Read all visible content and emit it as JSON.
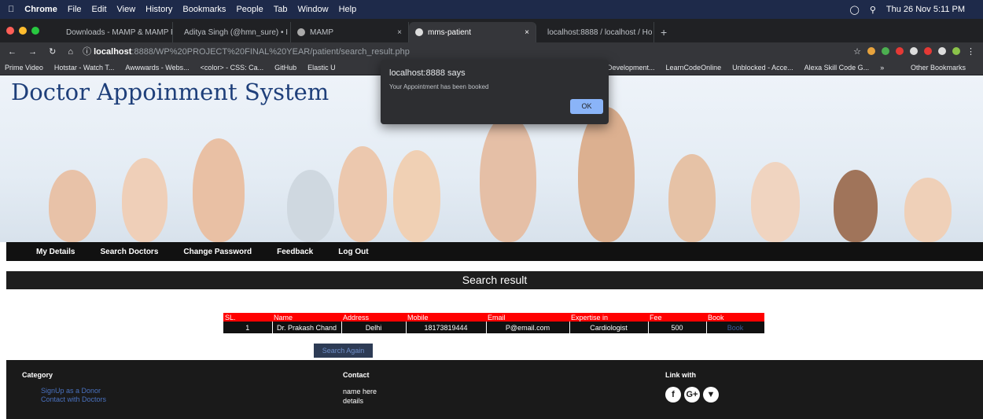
{
  "mac_menu": {
    "app": "Chrome",
    "items": [
      "File",
      "Edit",
      "View",
      "History",
      "Bookmarks",
      "People",
      "Tab",
      "Window",
      "Help"
    ],
    "datetime": "Thu 26 Nov 5:11 PM"
  },
  "tabs": [
    {
      "label": "Downloads - MAMP & MAMP P",
      "icon": "mamp-icon"
    },
    {
      "label": "Aditya Singh (@hmn_sure) • I",
      "icon": "instagram-icon"
    },
    {
      "label": "MAMP",
      "icon": "mamp-icon"
    },
    {
      "label": "mms-patient",
      "icon": "mamp-icon",
      "active": true
    },
    {
      "label": "localhost:8888 / localhost / Ho",
      "icon": "phpmyadmin-icon"
    }
  ],
  "address": {
    "host": "localhost",
    "path": ":8888/WP%20PROJECT%20FINAL%20YEAR/patient/search_result.php"
  },
  "bookmarks": {
    "left": [
      "Prime Video",
      "Hotstar - Watch T...",
      "Awwwards - Webs...",
      "<color> - CSS: Ca...",
      "GitHub",
      "Elastic U"
    ],
    "right": [
      "Development...",
      "LearnCodeOnline",
      "Unblocked - Acce...",
      "Alexa Skill Code G..."
    ],
    "more": "»",
    "other": "Other Bookmarks"
  },
  "site": {
    "title": "Doctor Appoinment System"
  },
  "menu": [
    "My Details",
    "Search Doctors",
    "Change Password",
    "Feedback",
    "Log Out"
  ],
  "result_title": "Search result",
  "table": {
    "headers": [
      "SL.",
      "Name",
      "Address",
      "Mobile",
      "Email",
      "Expertise in",
      "Fee",
      "Book"
    ],
    "rows": [
      [
        "1",
        "Dr. Prakash Chand",
        "Delhi",
        "18173819444",
        "P@email.com",
        "Cardiologist",
        "500",
        "Book"
      ]
    ]
  },
  "search_again": "Search Again",
  "footer": {
    "category_title": "Category",
    "category_links": [
      "SignUp as a Donor",
      "Contact with Doctors"
    ],
    "contact_title": "Contact",
    "contact_lines": [
      "name here",
      "details"
    ],
    "link_title": "Link with",
    "social": [
      "f",
      "G+",
      "▼"
    ]
  },
  "dialog": {
    "title": "localhost:8888 says",
    "message": "Your Appointment has been booked",
    "ok": "OK"
  },
  "colors": {
    "header_red": "#ff0000",
    "title_blue": "#1e3f7a",
    "link_blue": "#4a72c0",
    "dialog_button": "#8ab4f8"
  }
}
